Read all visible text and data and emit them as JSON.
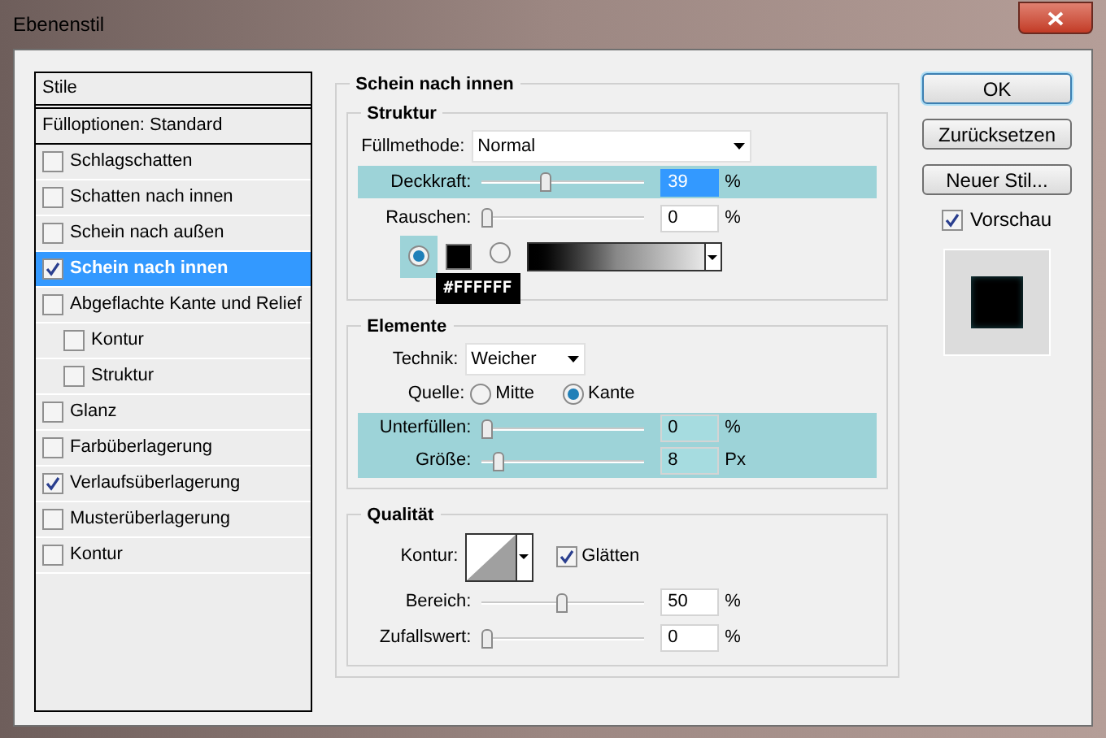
{
  "window": {
    "title": "Ebenenstil"
  },
  "styles_list": {
    "header": "Stile",
    "fill_options": "Fülloptionen: Standard",
    "items": [
      {
        "label": "Schlagschatten",
        "checked": false,
        "selected": false
      },
      {
        "label": "Schatten nach innen",
        "checked": false,
        "selected": false
      },
      {
        "label": "Schein nach außen",
        "checked": false,
        "selected": false
      },
      {
        "label": "Schein nach innen",
        "checked": true,
        "selected": true
      },
      {
        "label": "Abgeflachte Kante und Relief",
        "checked": false,
        "selected": false,
        "children": [
          {
            "label": "Kontur",
            "checked": false,
            "selected": false
          },
          {
            "label": "Struktur",
            "checked": false,
            "selected": false
          }
        ]
      },
      {
        "label": "Glanz",
        "checked": false,
        "selected": false
      },
      {
        "label": "Farbüberlagerung",
        "checked": false,
        "selected": false
      },
      {
        "label": "Verlaufsüberlagerung",
        "checked": true,
        "selected": false
      },
      {
        "label": "Musterüberlagerung",
        "checked": false,
        "selected": false
      },
      {
        "label": "Kontur",
        "checked": false,
        "selected": false
      }
    ]
  },
  "panel": {
    "title": "Schein nach innen",
    "struktur": {
      "title": "Struktur",
      "blend_mode": {
        "label": "Füllmethode:",
        "value": "Normal"
      },
      "sliders": [
        {
          "label": "Deckkraft:",
          "level": 0.39,
          "value": "39",
          "unit": "%",
          "highlighted": true,
          "text_selected": true
        },
        {
          "label": "Rauschen:",
          "level": 0,
          "value": "0",
          "unit": "%",
          "highlighted": false,
          "text_selected": false
        }
      ],
      "fill_sources": [
        {
          "kind": "color",
          "selected": true,
          "color": "#000000"
        },
        {
          "kind": "gradient",
          "selected": false
        }
      ],
      "tooltip": "#FFFFFF"
    },
    "elemente": {
      "title": "Elemente",
      "technique": {
        "label": "Technik:",
        "value": "Weicher"
      },
      "source": {
        "label": "Quelle:",
        "options": [
          {
            "label": "Mitte",
            "selected": false
          },
          {
            "label": "Kante",
            "selected": true
          }
        ]
      },
      "sliders": [
        {
          "label": "Unterfüllen:",
          "level": 0,
          "value": "0",
          "unit": "%",
          "highlighted": true,
          "text_selected": false
        },
        {
          "label": "Größe:",
          "level": 0.08,
          "value": "8",
          "unit": "Px",
          "highlighted": true,
          "text_selected": false
        }
      ]
    },
    "qualitaet": {
      "title": "Qualität",
      "contour": {
        "label": "Kontur:"
      },
      "antialias": {
        "label": "Glätten",
        "checked": true
      },
      "sliders": [
        {
          "label": "Bereich:",
          "level": 0.5,
          "value": "50",
          "unit": "%",
          "highlighted": false,
          "text_selected": false
        },
        {
          "label": "Zufallswert:",
          "level": 0,
          "value": "0",
          "unit": "%",
          "highlighted": false,
          "text_selected": false
        }
      ]
    }
  },
  "buttons": [
    {
      "label": "OK",
      "default": true
    },
    {
      "label": "Zurücksetzen",
      "default": false
    },
    {
      "label": "Neuer Stil...",
      "default": false
    }
  ],
  "preview": {
    "label": "Vorschau",
    "checked": true
  }
}
